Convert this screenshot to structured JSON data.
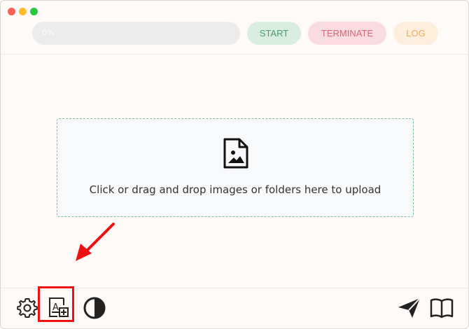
{
  "window": {
    "traffic_lights": {
      "close_color": "#fe5f57",
      "minimize_color": "#febb2e",
      "zoom_color": "#28c840"
    }
  },
  "toolbar": {
    "progress": {
      "label": "0%",
      "value": 0
    },
    "start_label": "START",
    "terminate_label": "TERMINATE",
    "log_label": "LOG"
  },
  "dropzone": {
    "icon": "file-image-icon",
    "text": "Click or drag and drop images or folders here to upload"
  },
  "bottom_bar": {
    "left_icons": [
      "gear-icon",
      "text-image-add-icon",
      "contrast-icon"
    ],
    "right_icons": [
      "send-icon",
      "book-icon"
    ]
  },
  "annotations": {
    "highlight_color": "#ee1111"
  }
}
